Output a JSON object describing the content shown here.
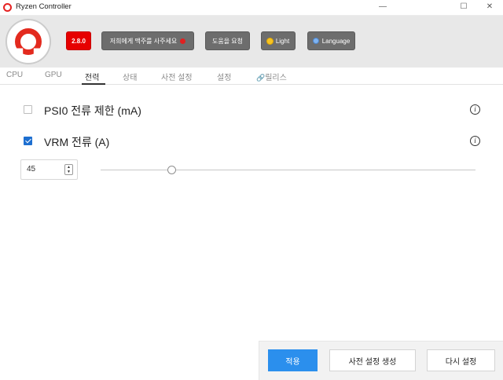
{
  "window": {
    "title": "Ryzen Controller",
    "minimize_glyph": "—",
    "maximize_glyph": "☐",
    "close_glyph": "✕"
  },
  "header": {
    "version_label": "2.8.0",
    "coffee_label": "저희에게 맥주를 사주세요",
    "help_label": "도움을 요청",
    "theme_label": "Light",
    "language_label": "Language"
  },
  "tabs": [
    {
      "label": "CPU",
      "active": false
    },
    {
      "label": "GPU",
      "active": false
    },
    {
      "label": "전력",
      "active": true
    },
    {
      "label": "상태",
      "active": false
    },
    {
      "label": "사전 설정",
      "active": false
    },
    {
      "label": "설정",
      "active": false
    },
    {
      "label": "릴리스",
      "active": false,
      "icon": "link-icon"
    }
  ],
  "settings": [
    {
      "label": "PSI0 전류 제한 (mA)",
      "checked": false,
      "info_glyph": "i"
    },
    {
      "label": "VRM 전류 (A)",
      "checked": true,
      "info_glyph": "i"
    }
  ],
  "vrm_current": {
    "value": "45",
    "stepper_up": "▲",
    "stepper_down": "▼",
    "slider_position": 0.19
  },
  "footer": {
    "apply_label": "적용",
    "create_preset_label": "사전 설정 생성",
    "reset_label": "다시 설정"
  },
  "colors": {
    "accent": "#2b8fed",
    "version_badge": "#e60000",
    "checkbox": "#1e6fd0",
    "header_bg": "#e8e8e8"
  }
}
